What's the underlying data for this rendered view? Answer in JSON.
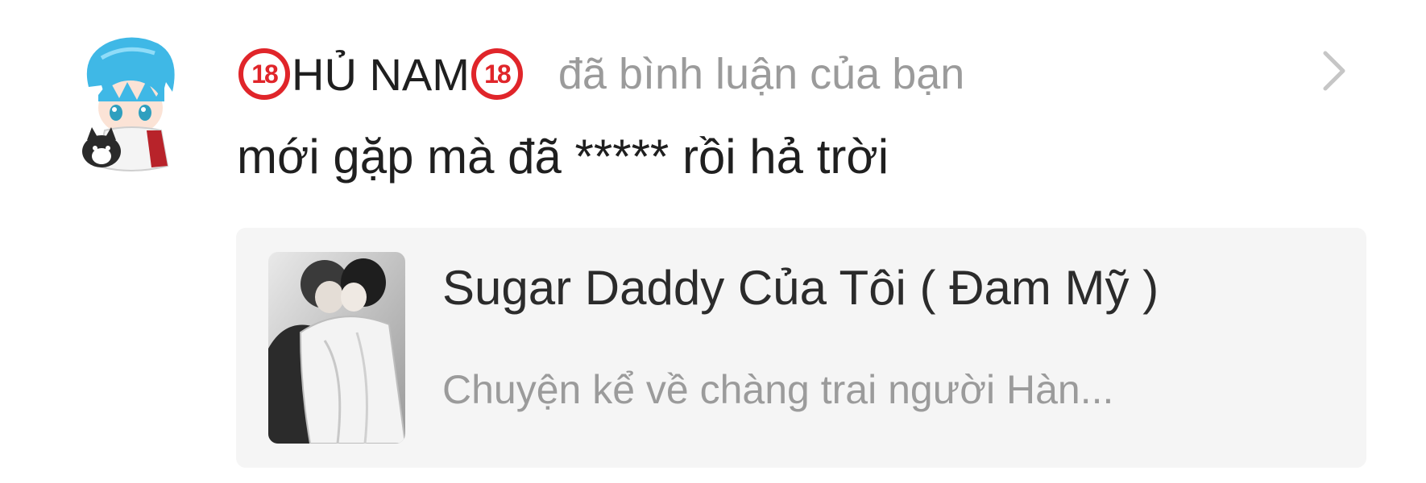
{
  "notification": {
    "avatar_icon": "anime-avatar-icon",
    "badge_left": "18",
    "username": "HỦ NAM",
    "badge_right": "18",
    "action": "đã bình luận của bạn",
    "chevron_icon": "chevron-right-icon",
    "comment": "mới gặp mà đã ***** rồi hả trời"
  },
  "card": {
    "cover_icon": "book-cover-thumbnail",
    "title": "Sugar Daddy Của Tôi ( Đam Mỹ )",
    "description": "Chuyện kể về chàng trai người Hàn..."
  },
  "colors": {
    "badge_red": "#e0252a",
    "text_primary": "#1f1f1f",
    "text_secondary": "#9b9b9b",
    "card_background": "#f5f5f5"
  }
}
